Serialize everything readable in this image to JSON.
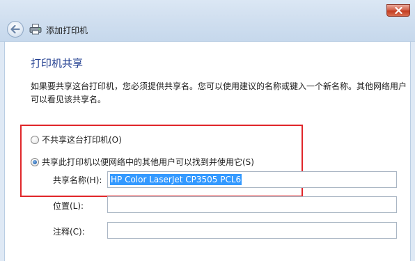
{
  "window": {
    "title": "添加打印机",
    "close_icon": "close-icon",
    "back_icon": "back-arrow-icon",
    "printer_icon": "printer-icon"
  },
  "page": {
    "heading": "打印机共享",
    "description": "如果要共享这台打印机，您必须提供共享名。您可以使用建议的名称或键入一个新名称。其他网络用户可以看见该共享名。"
  },
  "options": {
    "no_share": {
      "label": "不共享这台打印机(O)",
      "checked": false
    },
    "share": {
      "label": "共享此打印机以便网络中的其他用户可以找到并使用它(S)",
      "checked": true
    }
  },
  "fields": {
    "share_name": {
      "label": "共享名称(H):",
      "value": "HP Color LaserJet CP3505 PCL6"
    },
    "location": {
      "label": "位置(L):",
      "value": ""
    },
    "comment": {
      "label": "注释(C):",
      "value": ""
    }
  },
  "colors": {
    "heading": "#1f3c8f",
    "highlight_box": "#e0262a",
    "selection": "#3399ff"
  }
}
